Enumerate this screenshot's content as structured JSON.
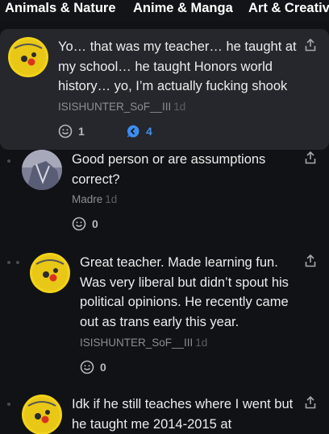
{
  "categories": [
    "Animals & Nature",
    "Anime & Manga",
    "Art & Creativ"
  ],
  "comments": [
    {
      "text_lines": [
        "Yo… that was my teacher… he taught at",
        "my school… he taught Honors world",
        "history… yo, I’m actually fucking shook"
      ],
      "author": "ISISHUNTER_SoF__III",
      "age": "1d",
      "likes": "1",
      "replies": "4",
      "avatar_text_top": "ISISHUNTER",
      "avatar_text_bottom": "SAPHU"
    },
    {
      "text_lines": [
        "Good person or are assumptions",
        "correct?"
      ],
      "author": "Madre",
      "age": "1d",
      "likes": "0"
    },
    {
      "text_lines": [
        "Great teacher. Made learning fun.",
        "Was very liberal but didn’t spout his",
        "political opinions. He recently came",
        "out as trans early this year."
      ],
      "author": "ISISHUNTER_SoF__III",
      "age": "1d",
      "likes": "0",
      "avatar_text_top": "ISISHUNTER",
      "avatar_text_bottom": "SAPHU"
    },
    {
      "text_lines": [
        "Idk if he still teaches where I went but",
        "he taught me 2014-2015 at"
      ],
      "avatar_text_top": "ISISHUNTER",
      "avatar_text_bottom": "SAPHU"
    }
  ],
  "colors": {
    "background": "#111215",
    "highlight": "#25272c",
    "reply_accent": "#3c8ff0",
    "avatar_yellow": "#f2d21b"
  },
  "icons": [
    "share-icon",
    "like-icon",
    "reply-bubble-icon"
  ]
}
